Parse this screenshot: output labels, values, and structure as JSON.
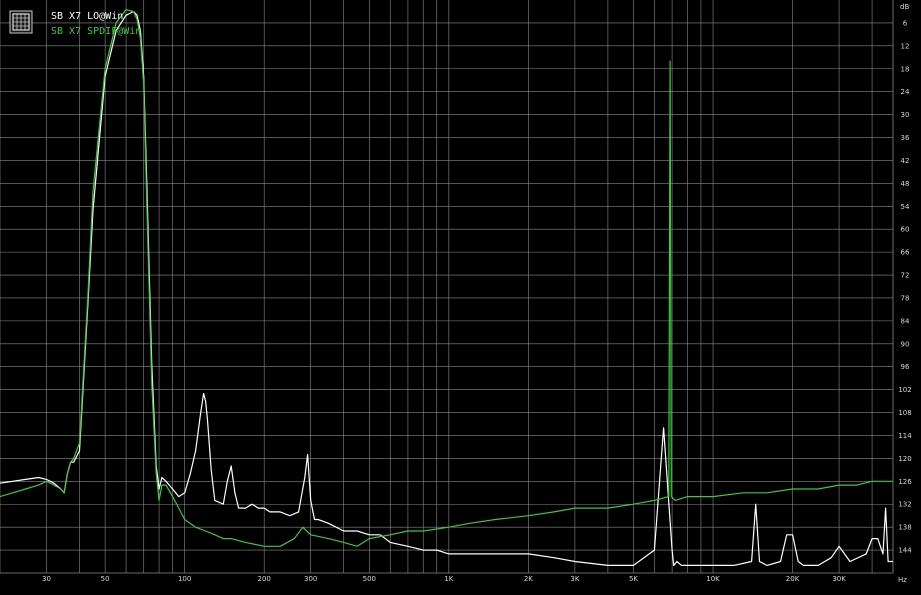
{
  "chart_data": {
    "type": "line",
    "xscale": "log",
    "xlim": [
      20,
      48000
    ],
    "ylim": [
      0,
      150
    ],
    "yaxis_unit": "dB",
    "xaxis_unit": "Hz",
    "grid": true,
    "legend_position": "top-left",
    "background": "#000000",
    "x_ticks": [
      {
        "value": 30,
        "label": "30"
      },
      {
        "value": 50,
        "label": "50"
      },
      {
        "value": 100,
        "label": "100"
      },
      {
        "value": 200,
        "label": "200"
      },
      {
        "value": 300,
        "label": "300"
      },
      {
        "value": 500,
        "label": "500"
      },
      {
        "value": 1000,
        "label": "1K"
      },
      {
        "value": 2000,
        "label": "2K"
      },
      {
        "value": 3000,
        "label": "3K"
      },
      {
        "value": 5000,
        "label": "5K"
      },
      {
        "value": 10000,
        "label": "10K"
      },
      {
        "value": 20000,
        "label": "20K"
      },
      {
        "value": 30000,
        "label": "30K"
      }
    ],
    "y_ticks": [
      6,
      12,
      18,
      24,
      30,
      36,
      42,
      48,
      54,
      60,
      66,
      72,
      78,
      84,
      90,
      96,
      102,
      108,
      114,
      120,
      126,
      132,
      138,
      144
    ],
    "series": [
      {
        "name": "SB X7 LO@Win",
        "color": "#ffffff",
        "x": [
          20,
          25,
          28,
          30,
          32,
          34,
          35,
          36,
          37,
          38,
          40,
          43,
          45,
          50,
          55,
          60,
          64,
          66,
          68,
          70,
          72,
          75,
          78,
          80,
          82,
          85,
          90,
          95,
          100,
          105,
          110,
          115,
          118,
          120,
          122,
          126,
          130,
          140,
          145,
          150,
          155,
          160,
          170,
          180,
          190,
          200,
          210,
          230,
          250,
          270,
          285,
          292,
          300,
          310,
          320,
          350,
          400,
          450,
          500,
          550,
          600,
          700,
          800,
          900,
          1000,
          1200,
          1500,
          2000,
          2500,
          3000,
          4000,
          5000,
          6000,
          6500,
          7000,
          7100,
          7300,
          7600,
          8000,
          9000,
          10000,
          12000,
          14000,
          14500,
          15000,
          16000,
          18000,
          19000,
          20000,
          21000,
          22000,
          25000,
          28000,
          30000,
          33000,
          38000,
          40000,
          42000,
          44000,
          45000,
          46000,
          48000
        ],
        "y": [
          126.5,
          125.5,
          125,
          125.5,
          126.5,
          128,
          129,
          124,
          121,
          121,
          118,
          80,
          55,
          20,
          8,
          4,
          3,
          4,
          8,
          20,
          50,
          95,
          122,
          128,
          125,
          126,
          128,
          130,
          129,
          124,
          118,
          108,
          103,
          105,
          110,
          123,
          131,
          132,
          126,
          122,
          129,
          133,
          133,
          132,
          133,
          133,
          134,
          134,
          135,
          134,
          125,
          119,
          131,
          136,
          136,
          137,
          139,
          139,
          140,
          140,
          142,
          143,
          144,
          144,
          145,
          145,
          145,
          145,
          146,
          147,
          148,
          148,
          144,
          112,
          144,
          148,
          147,
          148,
          148,
          148,
          148,
          148,
          147,
          132,
          147,
          148,
          147,
          140,
          140,
          147,
          148,
          148,
          146,
          143,
          147,
          145,
          141,
          141,
          145,
          133,
          147,
          147
        ]
      },
      {
        "name": "SB X7 SPDIF@Win",
        "color": "#3ec83e",
        "x": [
          20,
          25,
          28,
          30,
          32,
          34,
          35,
          36,
          37,
          38,
          40,
          43,
          45,
          50,
          55,
          60,
          64,
          66,
          68,
          70,
          72,
          75,
          78,
          80,
          82,
          85,
          90,
          95,
          100,
          110,
          120,
          130,
          140,
          150,
          170,
          200,
          230,
          260,
          280,
          300,
          350,
          400,
          450,
          500,
          600,
          700,
          800,
          1000,
          1200,
          1500,
          2000,
          2500,
          3000,
          4000,
          5000,
          6000,
          6800,
          6880,
          6950,
          7200,
          8000,
          10000,
          13000,
          16000,
          20000,
          25000,
          30000,
          35000,
          40000,
          44000,
          48000
        ],
        "y": [
          130,
          128,
          127,
          126,
          127,
          128,
          129,
          124,
          121,
          120,
          116,
          78,
          50,
          18,
          6,
          2.5,
          3,
          5,
          10,
          22,
          55,
          100,
          124,
          131,
          127,
          127,
          130,
          133,
          136,
          138,
          139,
          140,
          141,
          141,
          142,
          143,
          143,
          141,
          138,
          140,
          141,
          142,
          143,
          141,
          140,
          139,
          139,
          138,
          137,
          136,
          135,
          134,
          133,
          133,
          132,
          131,
          130,
          16,
          130,
          131,
          130,
          130,
          129,
          129,
          128,
          128,
          127,
          127,
          126,
          126,
          126
        ]
      }
    ]
  },
  "legend": {
    "icon": "grid-icon",
    "entries": [
      "SB X7 LO@Win",
      "SB X7 SPDIF@Win"
    ]
  },
  "axis": {
    "y_unit_label": "dB",
    "x_unit_label": "Hz"
  }
}
